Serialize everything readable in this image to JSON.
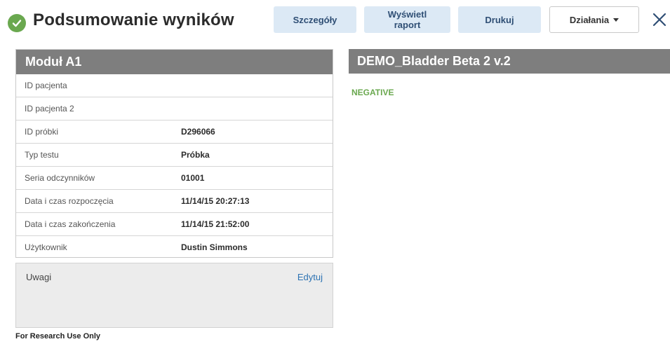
{
  "header": {
    "title": "Podsumowanie wyników",
    "buttons": {
      "details": "Szczegóły",
      "show_report": "Wyświetl raport",
      "print": "Drukuj",
      "actions": "Działania"
    }
  },
  "module": {
    "title": "Moduł A1",
    "rows": [
      {
        "label": "ID pacjenta",
        "value": ""
      },
      {
        "label": "ID pacjenta 2",
        "value": ""
      },
      {
        "label": "ID próbki",
        "value": "D296066"
      },
      {
        "label": "Typ testu",
        "value": "Próbka"
      },
      {
        "label": "Seria odczynników",
        "value": "01001"
      },
      {
        "label": "Data i czas rozpoczęcia",
        "value": "11/14/15 20:27:13"
      },
      {
        "label": "Data i czas zakończenia",
        "value": "11/14/15 21:52:00"
      },
      {
        "label": "Użytkownik",
        "value": "Dustin Simmons"
      }
    ]
  },
  "notes": {
    "label": "Uwagi",
    "edit": "Edytuj"
  },
  "assay": {
    "title": "DEMO_Bladder Beta 2 v.2",
    "result": "NEGATIVE"
  },
  "footer": "For Research Use Only",
  "colors": {
    "success": "#6aa84f",
    "panel_header": "#7e7e7e",
    "button_bg": "#dce9f5",
    "button_text": "#2f4f75",
    "link": "#2d73b3",
    "negative": "#6aa84f"
  },
  "icons": {
    "status": "check-circle-icon",
    "close": "close-icon",
    "dropdown": "caret-down-icon"
  }
}
